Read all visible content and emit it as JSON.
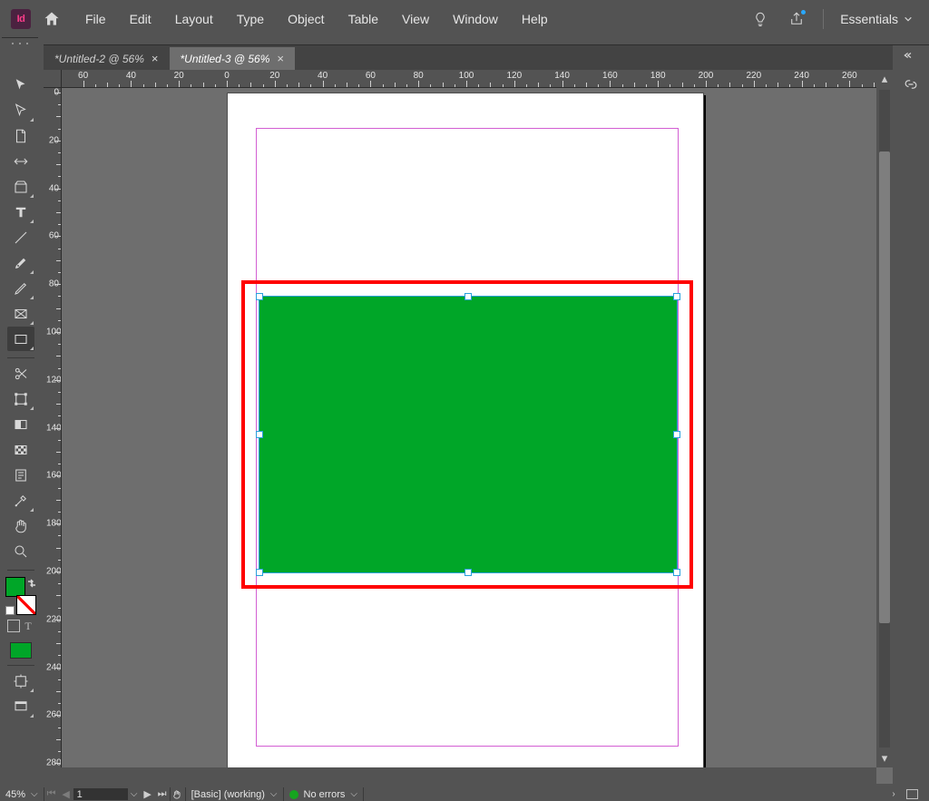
{
  "app": {
    "badge": "Id"
  },
  "menu": {
    "items": [
      "File",
      "Edit",
      "Layout",
      "Type",
      "Object",
      "Table",
      "View",
      "Window",
      "Help"
    ]
  },
  "workspace_switcher": {
    "label": "Essentials"
  },
  "tabs": [
    {
      "label": "*Untitled-2 @ 56%",
      "active": false
    },
    {
      "label": "*Untitled-3 @ 56%",
      "active": true
    }
  ],
  "rulers": {
    "h_labels": [
      "60",
      "40",
      "20",
      "0",
      "20",
      "40",
      "60",
      "80",
      "100",
      "120",
      "140",
      "160",
      "180",
      "200",
      "220",
      "240",
      "260"
    ],
    "v_labels": [
      "0",
      "20",
      "40",
      "60",
      "80",
      "100",
      "120",
      "140",
      "160",
      "180",
      "200",
      "220",
      "240",
      "260",
      "280"
    ]
  },
  "status": {
    "zoom": "45%",
    "page": "1",
    "profile": "[Basic] (working)",
    "errors": "No errors"
  },
  "colors": {
    "fill": "#00a628",
    "selection": "#2aa0dd",
    "annotation": "#ff0000",
    "margin": "#d35fd3"
  }
}
